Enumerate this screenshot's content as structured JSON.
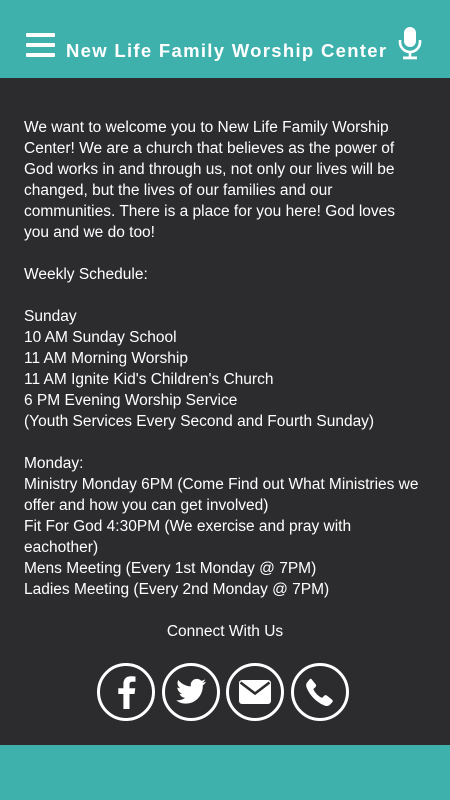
{
  "header": {
    "title": "New Life Family Worship Center",
    "menu_icon": "hamburger-menu-icon",
    "mic_icon": "microphone-icon",
    "background_color": "#3fb1ad"
  },
  "content": {
    "welcome": "We want to welcome you to New Life Family Worship Center! We are a church that believes as the power of God works in and through us, not only our lives will be changed, but the lives of our families and our communities. There is a place for you here! God loves you and we do too!",
    "schedule_heading": "Weekly Schedule:",
    "sunday": {
      "day": "Sunday",
      "items": [
        "10 AM Sunday School",
        "11 AM Morning Worship",
        "11 AM Ignite Kid's Children's Church",
        "6 PM Evening Worship Service",
        "(Youth Services Every Second and Fourth Sunday)"
      ]
    },
    "monday": {
      "day": "Monday:",
      "items": [
        "Ministry Monday  6PM (Come Find out What Ministries we offer and how you can get involved)",
        "Fit For God 4:30PM (We exercise and pray with eachother)",
        "Mens Meeting (Every 1st Monday @ 7PM)",
        "Ladies Meeting (Every 2nd Monday @ 7PM)"
      ]
    }
  },
  "connect": {
    "title": "Connect With Us",
    "icons": [
      "facebook-icon",
      "twitter-icon",
      "email-icon",
      "phone-icon"
    ]
  },
  "colors": {
    "background": "#2c2b2d",
    "accent": "#3fb1ad",
    "text": "#ffffff"
  }
}
